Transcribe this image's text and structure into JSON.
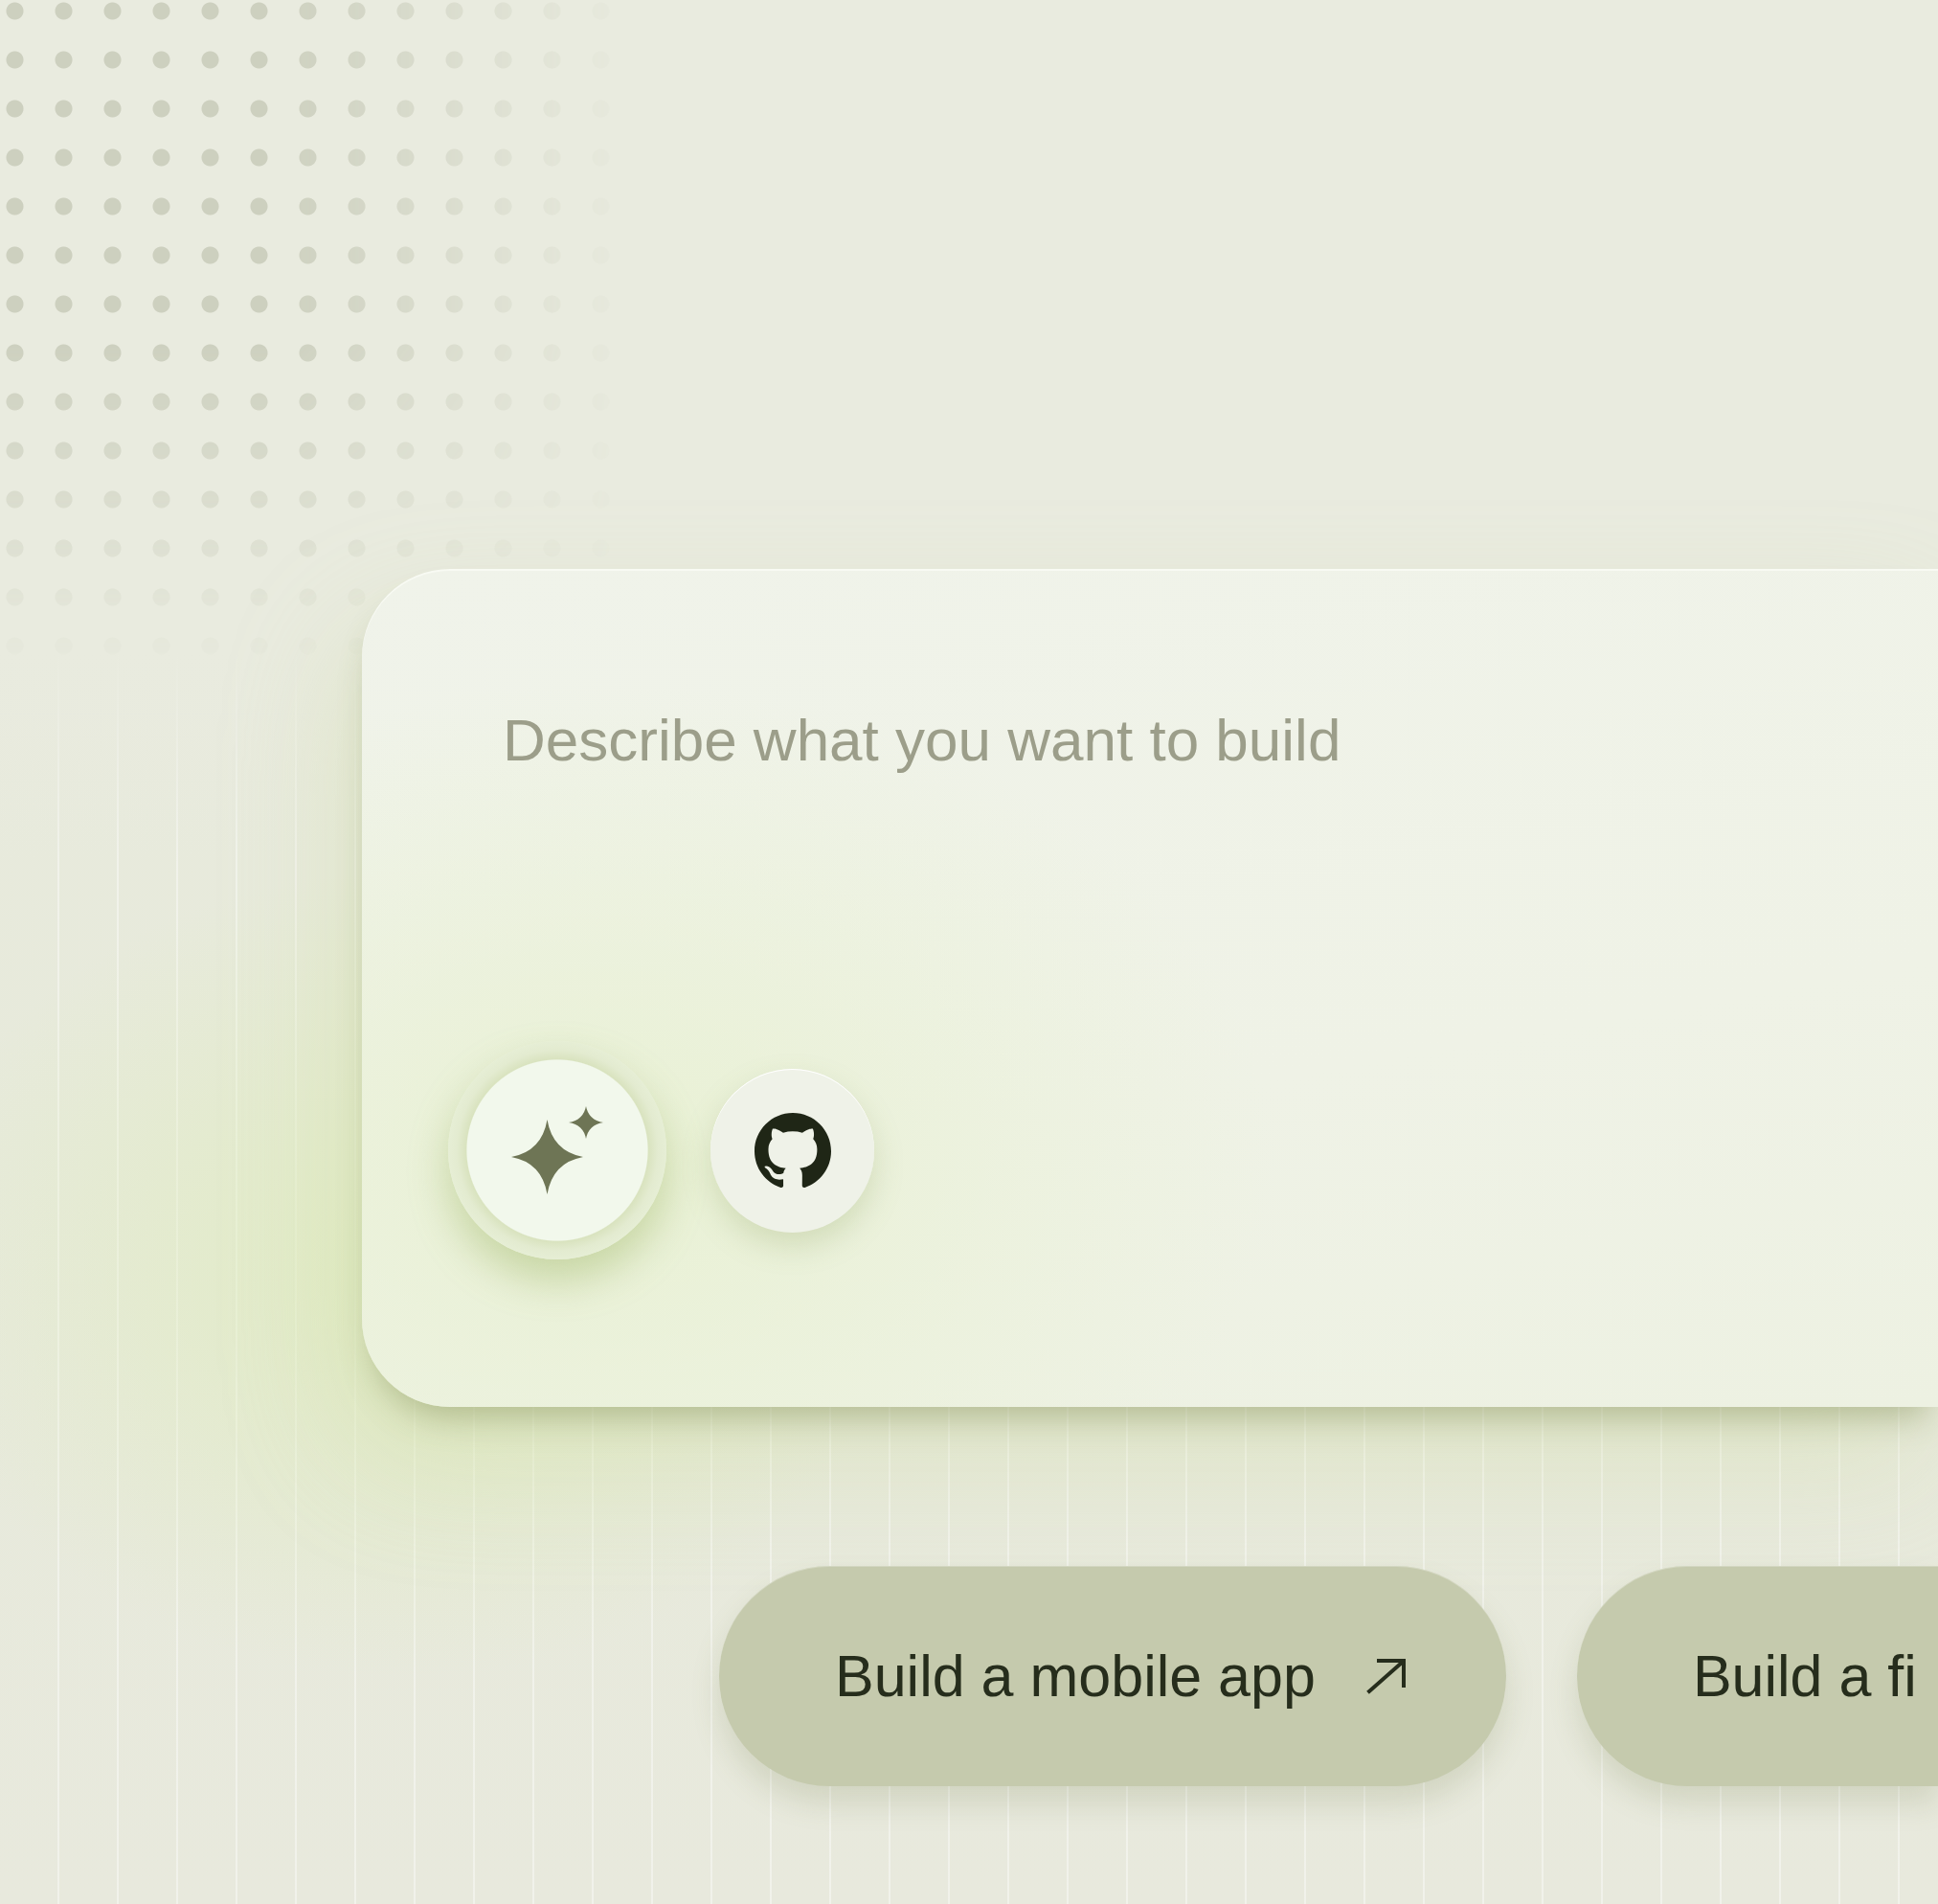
{
  "prompt_box": {
    "placeholder": "Describe what you want to build",
    "tools": [
      {
        "kind": "sparkle",
        "active": true
      },
      {
        "kind": "github",
        "active": false
      }
    ]
  },
  "suggestions": [
    {
      "label": "Build a mobile app",
      "arrow": true
    },
    {
      "label": "Build a fi"
    }
  ]
}
